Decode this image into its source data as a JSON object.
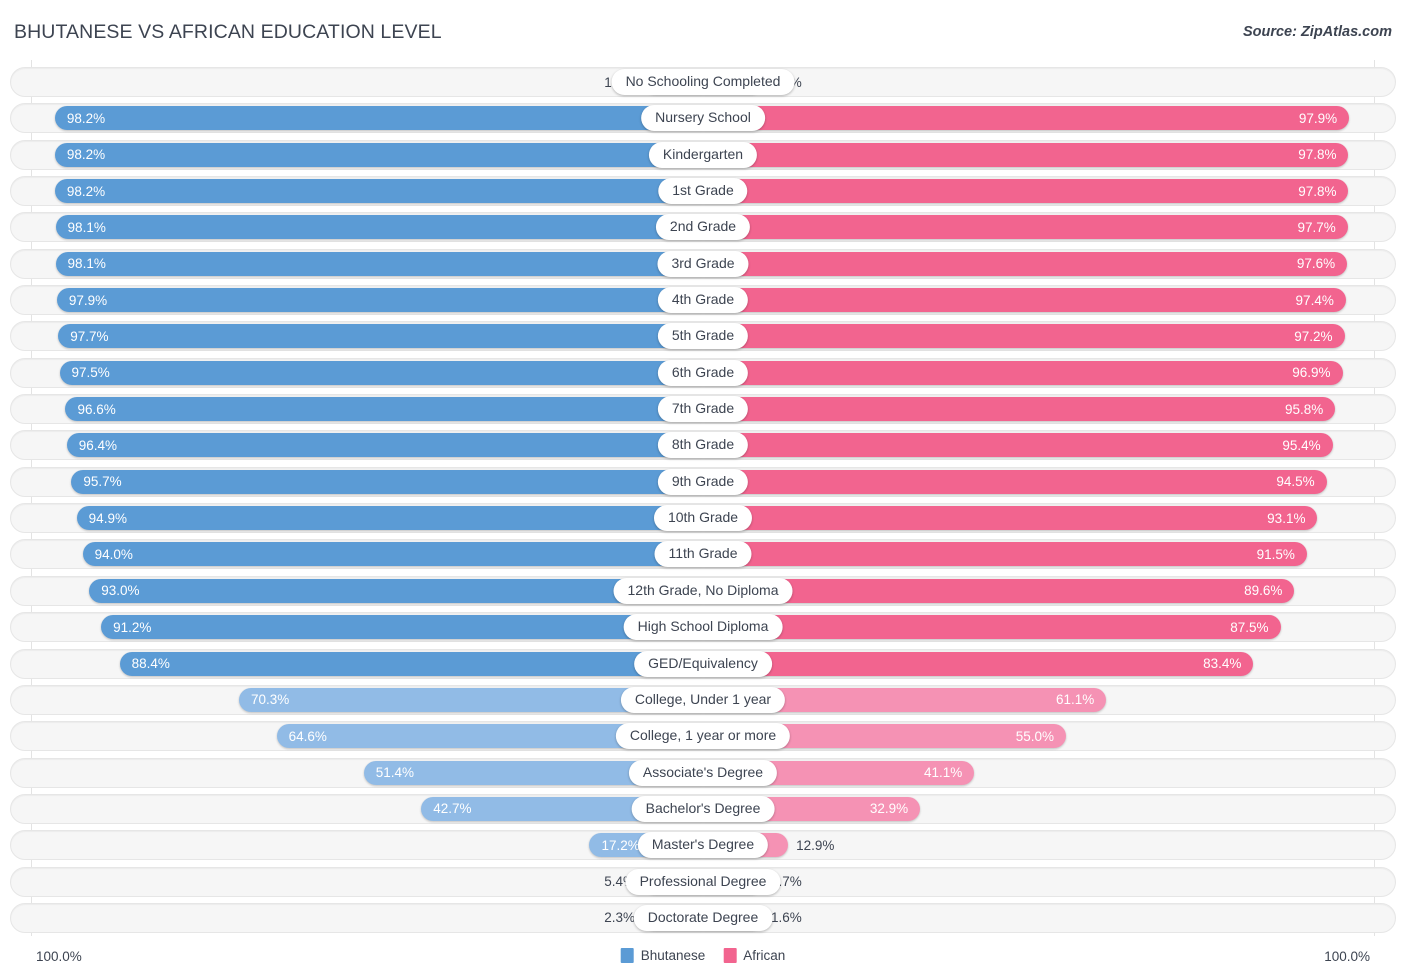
{
  "header": {
    "title": "BHUTANESE VS AFRICAN EDUCATION LEVEL",
    "source": "Source: ZipAtlas.com"
  },
  "axis": {
    "left_max": "100.0%",
    "right_max": "100.0%"
  },
  "legend": {
    "items": [
      {
        "label": "Bhutanese",
        "color": "#5b9bd5"
      },
      {
        "label": "African",
        "color": "#f2648f"
      }
    ]
  },
  "colors": {
    "blue": "#5b9bd5",
    "blue_light": "#91bbe6",
    "pink": "#f2648f",
    "pink_light": "#f592b4",
    "track": "#f6f6f6",
    "text": "#3d4451"
  },
  "chart_data": {
    "type": "bar",
    "orientation": "horizontal-diverging",
    "title": "BHUTANESE VS AFRICAN EDUCATION LEVEL",
    "xlabel": "",
    "ylabel": "",
    "xlim": [
      0,
      100
    ],
    "grid": false,
    "legend_position": "bottom-center",
    "categories": [
      "No Schooling Completed",
      "Nursery School",
      "Kindergarten",
      "1st Grade",
      "2nd Grade",
      "3rd Grade",
      "4th Grade",
      "5th Grade",
      "6th Grade",
      "7th Grade",
      "8th Grade",
      "9th Grade",
      "10th Grade",
      "11th Grade",
      "12th Grade, No Diploma",
      "High School Diploma",
      "GED/Equivalency",
      "College, Under 1 year",
      "College, 1 year or more",
      "Associate's Degree",
      "Bachelor's Degree",
      "Master's Degree",
      "Professional Degree",
      "Doctorate Degree"
    ],
    "series": [
      {
        "name": "Bhutanese",
        "color": "#5b9bd5",
        "values": [
          1.8,
          98.2,
          98.2,
          98.2,
          98.1,
          98.1,
          97.9,
          97.7,
          97.5,
          96.6,
          96.4,
          95.7,
          94.9,
          94.0,
          93.0,
          91.2,
          88.4,
          70.3,
          64.6,
          51.4,
          42.7,
          17.2,
          5.4,
          2.3
        ],
        "labels": [
          "1.8%",
          "98.2%",
          "98.2%",
          "98.2%",
          "98.1%",
          "98.1%",
          "97.9%",
          "97.7%",
          "97.5%",
          "96.6%",
          "96.4%",
          "95.7%",
          "94.9%",
          "94.0%",
          "93.0%",
          "91.2%",
          "88.4%",
          "70.3%",
          "64.6%",
          "51.4%",
          "42.7%",
          "17.2%",
          "5.4%",
          "2.3%"
        ]
      },
      {
        "name": "African",
        "color": "#f2648f",
        "values": [
          2.2,
          97.9,
          97.8,
          97.8,
          97.7,
          97.6,
          97.4,
          97.2,
          96.9,
          95.8,
          95.4,
          94.5,
          93.1,
          91.5,
          89.6,
          87.5,
          83.4,
          61.1,
          55.0,
          41.1,
          32.9,
          12.9,
          3.7,
          1.6
        ],
        "labels": [
          "2.2%",
          "97.9%",
          "97.8%",
          "97.8%",
          "97.7%",
          "97.6%",
          "97.4%",
          "97.2%",
          "96.9%",
          "95.8%",
          "95.4%",
          "94.5%",
          "93.1%",
          "91.5%",
          "89.6%",
          "87.5%",
          "83.4%",
          "61.1%",
          "55.0%",
          "41.1%",
          "32.9%",
          "12.9%",
          "3.7%",
          "1.6%"
        ]
      }
    ]
  }
}
